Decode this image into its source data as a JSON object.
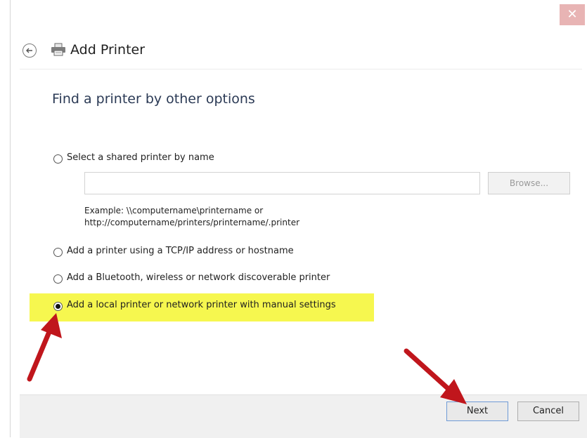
{
  "window": {
    "close_glyph": "✕",
    "title": "Add Printer",
    "back_icon": "back-arrow-icon",
    "printer_icon": "printer-icon"
  },
  "main": {
    "heading": "Find a printer by other options",
    "options": [
      {
        "label": "Select a shared printer by name",
        "selected": false
      },
      {
        "label": "Add a printer using a TCP/IP address or hostname",
        "selected": false
      },
      {
        "label": "Add a Bluetooth, wireless or network discoverable printer",
        "selected": false
      },
      {
        "label": "Add a local printer or network printer with manual settings",
        "selected": true
      }
    ],
    "shared_printer": {
      "input_value": "",
      "browse_label": "Browse...",
      "example_line1": "Example: \\\\computername\\printername or",
      "example_line2": "http://computername/printers/printername/.printer"
    }
  },
  "footer": {
    "next_label": "Next",
    "cancel_label": "Cancel"
  },
  "annotations": {
    "highlight_color": "#f6f74f",
    "arrow_color": "#c0161c"
  }
}
